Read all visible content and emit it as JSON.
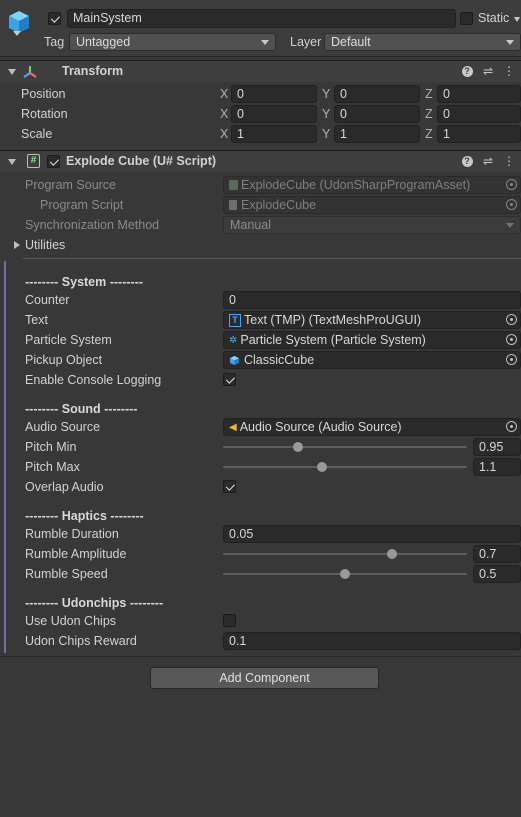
{
  "gameobject": {
    "name": "MainSystem",
    "active": true,
    "static_label": "Static",
    "tag_label": "Tag",
    "tag_value": "Untagged",
    "layer_label": "Layer",
    "layer_value": "Default"
  },
  "transform": {
    "title": "Transform",
    "rows": [
      {
        "label": "Position",
        "x": "0",
        "y": "0",
        "z": "0"
      },
      {
        "label": "Rotation",
        "x": "0",
        "y": "0",
        "z": "0"
      },
      {
        "label": "Scale",
        "x": "1",
        "y": "1",
        "z": "1"
      }
    ],
    "axis_x": "X",
    "axis_y": "Y",
    "axis_z": "Z"
  },
  "script": {
    "title": "Explode Cube (U# Script)",
    "enabled": true,
    "program_source_label": "Program Source",
    "program_source_value": "ExplodeCube (UdonSharpProgramAsset)",
    "program_script_label": "Program Script",
    "program_script_value": "ExplodeCube",
    "sync_label": "Synchronization Method",
    "sync_value": "Manual",
    "utilities_label": "Utilities"
  },
  "system": {
    "heading": "-------- System --------",
    "counter_label": "Counter",
    "counter_value": "0",
    "text_label": "Text",
    "text_value": "Text (TMP) (TextMeshProUGUI)",
    "particle_label": "Particle System",
    "particle_value": "Particle System (Particle System)",
    "pickup_label": "Pickup Object",
    "pickup_value": "ClassicCube",
    "logging_label": "Enable Console Logging",
    "logging_value": true
  },
  "sound": {
    "heading": "-------- Sound --------",
    "audio_label": "Audio Source",
    "audio_value": "Audio Source (Audio Source)",
    "pitch_min_label": "Pitch Min",
    "pitch_min_value": "0.95",
    "pitch_min_fraction": 0.3,
    "pitch_max_label": "Pitch Max",
    "pitch_max_value": "1.1",
    "pitch_max_fraction": 0.4,
    "overlap_label": "Overlap Audio",
    "overlap_value": true
  },
  "haptics": {
    "heading": "-------- Haptics --------",
    "duration_label": "Rumble Duration",
    "duration_value": "0.05",
    "amplitude_label": "Rumble Amplitude",
    "amplitude_value": "0.7",
    "amplitude_fraction": 0.7,
    "speed_label": "Rumble Speed",
    "speed_value": "0.5",
    "speed_fraction": 0.5
  },
  "udonchips": {
    "heading": "-------- Udonchips --------",
    "use_label": "Use Udon Chips",
    "use_value": false,
    "reward_label": "Udon Chips Reward",
    "reward_value": "0.1"
  },
  "add_component_label": "Add Component",
  "colors": {
    "background": "#383838",
    "field": "#2a2a2a",
    "header": "#3e3e3e",
    "accent_bar": "#6f6fb4"
  },
  "icons": [
    "gameobject-cube-icon",
    "transform-axes-icon",
    "script-hash-icon",
    "help-icon",
    "settings-sliders-icon",
    "kebab-menu-icon",
    "object-picker-icon",
    "text-icon",
    "particle-icon",
    "cube-icon",
    "audio-icon"
  ]
}
